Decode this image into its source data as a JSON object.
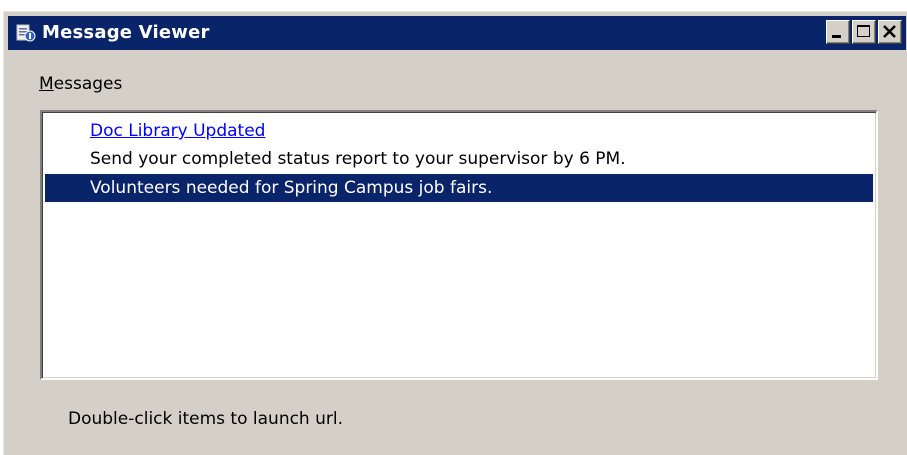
{
  "window": {
    "title": "Message Viewer",
    "icon": "message-viewer-app-icon",
    "controls": {
      "minimize": "minimize-icon",
      "maximize": "maximize-icon",
      "close": "close-icon"
    }
  },
  "messages": {
    "label_mnemonic": "M",
    "label_rest": "essages",
    "items": [
      {
        "text": "Doc Library Updated",
        "style": "link"
      },
      {
        "text": "Send your completed status report to your supervisor by 6 PM.",
        "style": "normal"
      },
      {
        "text": "Volunteers needed for Spring Campus job fairs.",
        "style": "selected"
      }
    ]
  },
  "hint": "Double-click items to launch url.",
  "colors": {
    "titlebar": "#0a246a",
    "window_bg": "#d4d0c8",
    "selection_bg": "#0a246a",
    "link": "#0000ff"
  }
}
